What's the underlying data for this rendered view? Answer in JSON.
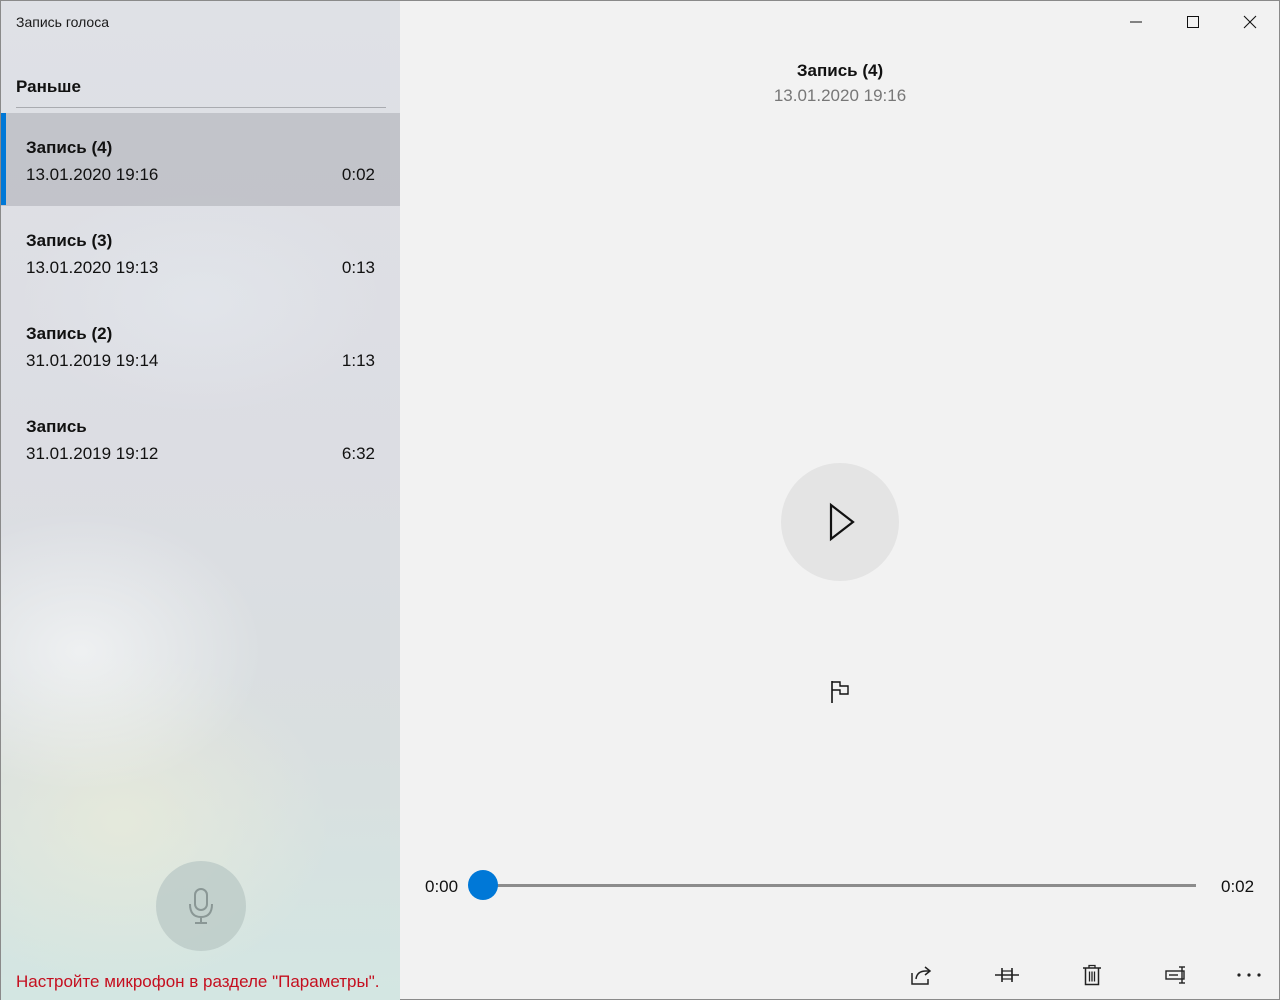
{
  "app": {
    "title": "Запись голоса"
  },
  "sidebar": {
    "section_header": "Раньше",
    "recordings": [
      {
        "name": "Запись (4)",
        "date": "13.01.2020 19:16",
        "duration": "0:02",
        "selected": true
      },
      {
        "name": "Запись (3)",
        "date": "13.01.2020 19:13",
        "duration": "0:13",
        "selected": false
      },
      {
        "name": "Запись (2)",
        "date": "31.01.2019 19:14",
        "duration": "1:13",
        "selected": false
      },
      {
        "name": "Запись",
        "date": "31.01.2019 19:12",
        "duration": "6:32",
        "selected": false
      }
    ],
    "record_button_icon": "microphone-icon",
    "mic_hint": "Настройте микрофон в разделе \"Параметры\"."
  },
  "detail": {
    "title": "Запись (4)",
    "date": "13.01.2020 19:16",
    "play_icon": "play-icon",
    "marker_icon": "flag-icon"
  },
  "player": {
    "current_time": "0:00",
    "total_time": "0:02",
    "progress": 0
  },
  "toolbar": {
    "icons": [
      "share-icon",
      "trim-icon",
      "delete-icon",
      "rename-icon",
      "more-icon"
    ]
  },
  "window_controls": [
    "minimize-icon",
    "maximize-icon",
    "close-icon"
  ],
  "colors": {
    "accent": "#0078d7",
    "warning_text": "#c50f1f",
    "secondary_text": "#777777"
  }
}
